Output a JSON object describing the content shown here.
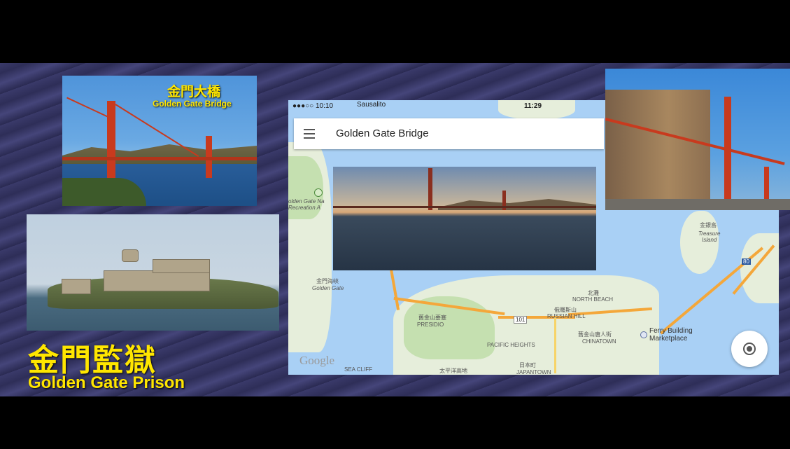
{
  "scene": {
    "bridge_caption": {
      "cjk": "金門大橋",
      "en": "Golden Gate Bridge"
    },
    "prison_caption": {
      "cjk": "金門監獄",
      "en": "Golden Gate Prison"
    }
  },
  "map": {
    "status_bar": {
      "carrier": "●●●○○ 10:10",
      "location": "Sausalito",
      "time": "11:29"
    },
    "search": {
      "title": "Golden Gate Bridge"
    },
    "labels": {
      "recreation_area": "olden Gate Na\nRecreation A",
      "strait_cjk": "金門海峽",
      "strait_en": "Golden Gate",
      "treasure_cjk": "金銀島",
      "treasure_en": "Treasure\nIsland",
      "north_beach_cjk": "北灘",
      "north_beach_en": "NORTH BEACH",
      "russian_hill_cjk": "俄羅斯山",
      "russian_hill_en": "RUSSIAN HILL",
      "presidio_cjk": "舊金山要塞",
      "presidio_en": "PRESIDIO",
      "pacific_heights": "PACIFIC HEIGHTS",
      "chinatown_cjk": "舊金山唐人街",
      "chinatown_en": "CHINATOWN",
      "ferry_building": "Ferry Building\nMarketplace",
      "sea_cliff": "SEA CLIFF",
      "japantown_cjk": "日本町",
      "japantown_en": "JAPANTOWN",
      "hwy101": "101",
      "hwy80": "80",
      "pac_heights_cjk": "太平洋高地"
    },
    "google_logo": "Google"
  },
  "colors": {
    "caption_yellow": "#ffe600",
    "map_water": "#a9d0f5",
    "highway": "#f4a73a"
  }
}
